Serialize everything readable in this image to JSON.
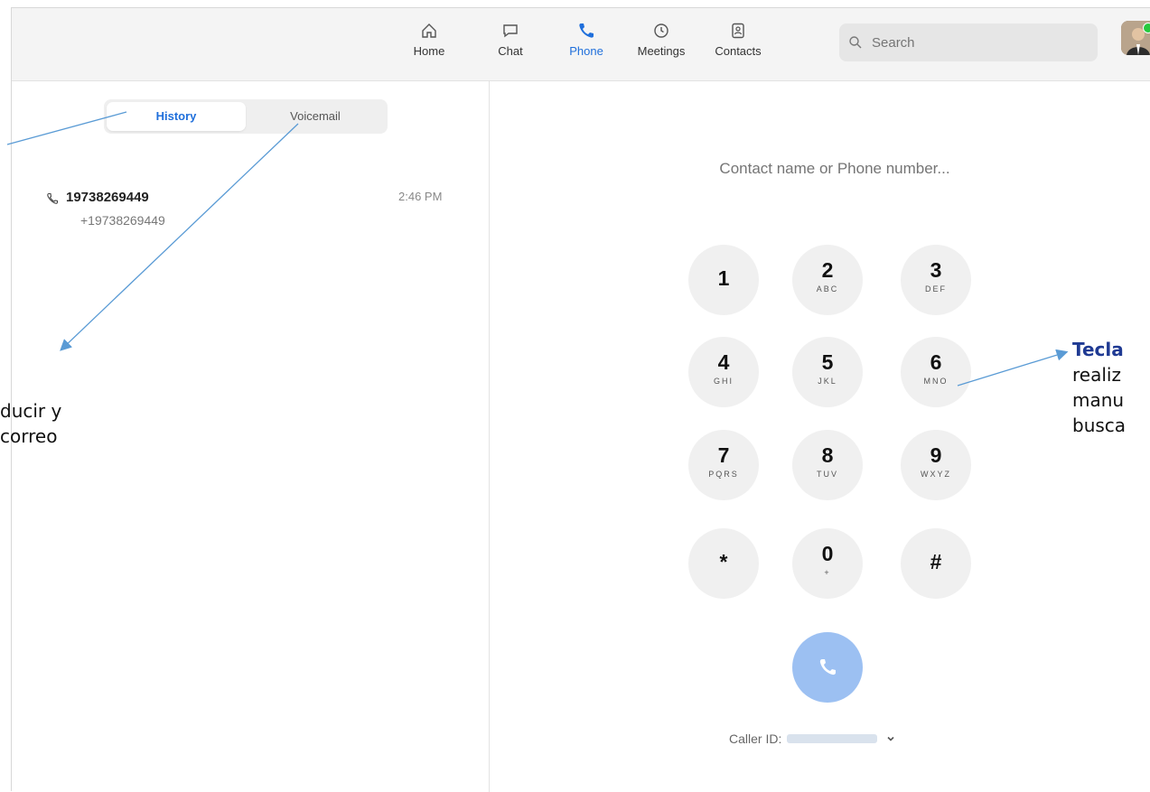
{
  "nav": {
    "items": [
      {
        "label": "Home"
      },
      {
        "label": "Chat"
      },
      {
        "label": "Phone"
      },
      {
        "label": "Meetings"
      },
      {
        "label": "Contacts"
      }
    ],
    "active": "Phone",
    "search_placeholder": "Search"
  },
  "tabs": [
    "History",
    "Voicemail"
  ],
  "history": [
    {
      "name": "19738269449",
      "sub": "+19738269449",
      "time": "2:46 PM"
    }
  ],
  "dialer": {
    "placeholder": "Contact name or Phone number...",
    "keys": [
      {
        "d": "1",
        "l": ""
      },
      {
        "d": "2",
        "l": "ABC"
      },
      {
        "d": "3",
        "l": "DEF"
      },
      {
        "d": "4",
        "l": "GHI"
      },
      {
        "d": "5",
        "l": "JKL"
      },
      {
        "d": "6",
        "l": "MNO"
      },
      {
        "d": "7",
        "l": "PQRS"
      },
      {
        "d": "8",
        "l": "TUV"
      },
      {
        "d": "9",
        "l": "WXYZ"
      },
      {
        "d": "*",
        "l": ""
      },
      {
        "d": "0",
        "l": "+"
      },
      {
        "d": "#",
        "l": ""
      }
    ],
    "caller_label": "Caller ID:"
  },
  "annotations": {
    "left_line1": "ducir y",
    "left_line2": "correo",
    "right_line1": "Tecla",
    "right_line2": "realiz",
    "right_line3": "manu",
    "right_line4": "busca"
  },
  "colors": {
    "accent": "#1f6fdb",
    "call_button": "#9cc0f2",
    "arrow": "#5a9bd5",
    "annotation_highlight": "#1f3a93"
  }
}
